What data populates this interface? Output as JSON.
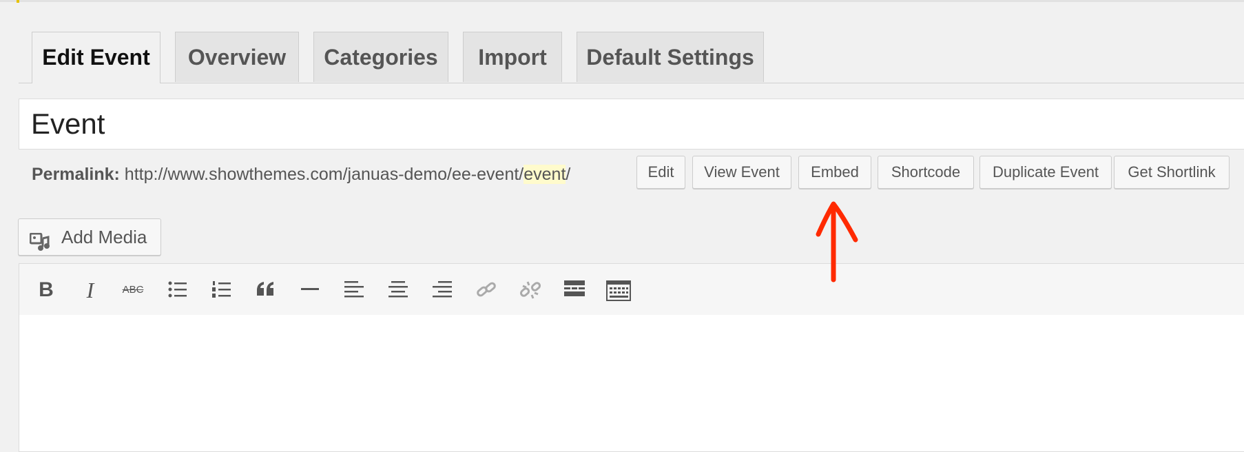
{
  "tabs": [
    {
      "label": "Edit Event",
      "active": true
    },
    {
      "label": "Overview"
    },
    {
      "label": "Categories"
    },
    {
      "label": "Import"
    },
    {
      "label": "Default Settings"
    }
  ],
  "title": {
    "value": "Event"
  },
  "permalink": {
    "label": "Permalink:",
    "url_prefix": "http://www.showthemes.com/januas-demo/ee-event/",
    "slug": "event",
    "url_suffix": "/",
    "highlight_color": "#fffbcc"
  },
  "permalink_buttons": {
    "edit": "Edit",
    "view_event": "View Event",
    "embed": "Embed",
    "shortcode": "Shortcode",
    "duplicate_event": "Duplicate Event",
    "get_shortlink": "Get Shortlink"
  },
  "add_media": {
    "label": "Add Media",
    "icon": "add-media-icon"
  },
  "toolbar": {
    "bold": "B",
    "italic": "I",
    "strikethrough": "ABC",
    "icons": [
      "bold-icon",
      "italic-icon",
      "strikethrough-icon",
      "bullet-list-icon",
      "numbered-list-icon",
      "blockquote-icon",
      "horizontal-rule-icon",
      "align-left-icon",
      "align-center-icon",
      "align-right-icon",
      "link-icon",
      "unlink-icon",
      "read-more-icon",
      "toolbar-toggle-icon"
    ]
  },
  "annotation": {
    "color": "#ff2a00",
    "icon": "red-arrow-icon"
  }
}
